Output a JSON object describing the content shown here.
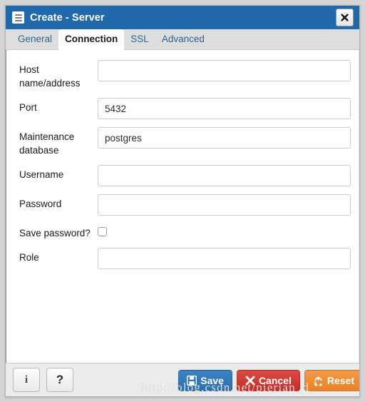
{
  "window": {
    "title": "Create - Server",
    "title_icon": "server-icon",
    "close_icon": "close-icon",
    "titlebar_color": "#2169ab"
  },
  "tabs": [
    {
      "label": "General",
      "active": false
    },
    {
      "label": "Connection",
      "active": true
    },
    {
      "label": "SSL",
      "active": false
    },
    {
      "label": "Advanced",
      "active": false
    }
  ],
  "form": {
    "fields": [
      {
        "label": "Host name/address",
        "value": "",
        "placeholder": "",
        "type": "text"
      },
      {
        "label": "Port",
        "value": "5432",
        "placeholder": "",
        "type": "text"
      },
      {
        "label": "Maintenance database",
        "value": "postgres",
        "placeholder": "",
        "type": "text"
      },
      {
        "label": "Username",
        "value": "",
        "placeholder": "",
        "type": "text"
      },
      {
        "label": "Password",
        "value": "",
        "placeholder": "",
        "type": "password"
      },
      {
        "label": "Save password?",
        "checked": false,
        "type": "checkbox"
      },
      {
        "label": "Role",
        "value": "",
        "placeholder": "",
        "type": "text"
      }
    ]
  },
  "footer": {
    "info_label": "i",
    "info_icon": "info-icon",
    "help_label": "?",
    "help_icon": "question-mark-icon",
    "save_label": "Save",
    "save_icon": "floppy-disk-save-icon",
    "save_color": "#2a6ead",
    "cancel_label": "Cancel",
    "cancel_icon": "x-cross-icon",
    "cancel_color": "#c42f28",
    "reset_label": "Reset",
    "reset_icon": "recycle-refresh-icon",
    "reset_color": "#ea8225"
  },
  "watermark": {
    "text": "http://blog.csdn.net/pierian_d"
  }
}
